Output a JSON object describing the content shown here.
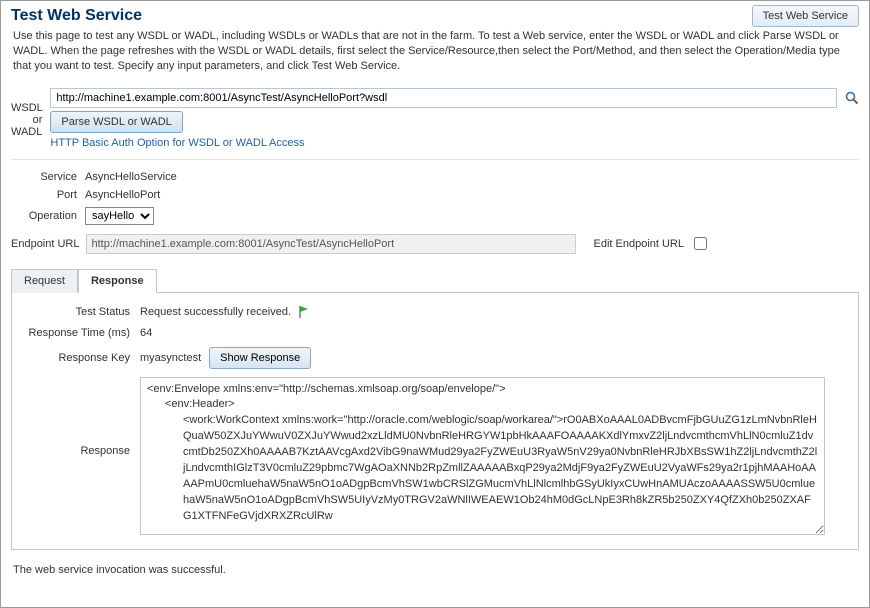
{
  "header": {
    "title": "Test Web Service",
    "button": "Test Web Service"
  },
  "intro": "Use this page to test any WSDL or WADL, including WSDLs or WADLs that are not in the farm. To test a Web service, enter the WSDL or WADL and click Parse WSDL or WADL. When the page refreshes with the WSDL or WADL details, first select the Service/Resource,then select the Port/Method, and then select the Operation/Media type that you want to test. Specify any input parameters, and click Test Web Service.",
  "wsdl": {
    "label": "WSDL or WADL",
    "url": "http://machine1.example.com:8001/AsyncTest/AsyncHelloPort?wsdl",
    "parse_btn": "Parse WSDL or WADL",
    "auth_link": "HTTP Basic Auth Option for WSDL or WADL Access"
  },
  "fields": {
    "service_label": "Service",
    "service_value": "AsyncHelloService",
    "port_label": "Port",
    "port_value": "AsyncHelloPort",
    "operation_label": "Operation",
    "operation_value": "sayHello",
    "endpoint_label": "Endpoint URL",
    "endpoint_value": "http://machine1.example.com:8001/AsyncTest/AsyncHelloPort",
    "edit_endpoint_label": "Edit Endpoint URL"
  },
  "tabs": {
    "request": "Request",
    "response": "Response"
  },
  "response": {
    "status_label": "Test Status",
    "status_value": "Request successfully received.",
    "time_label": "Response Time (ms)",
    "time_value": "64",
    "key_label": "Response Key",
    "key_value": "myasynctest",
    "show_btn": "Show Response",
    "body_label": "Response",
    "body_line1": "<env:Envelope xmlns:env=\"http://schemas.xmlsoap.org/soap/envelope/\">",
    "body_line2": "<env:Header>",
    "body_line3": "<work:WorkContext xmlns:work=\"http://oracle.com/weblogic/soap/workarea/\">rO0ABXoAAAL0ADBvcmFjbGUuZG1zLmNvbnRleHQuaW50ZXJuYWwuV0ZXJuYWwud2xzLldMU0NvbnRleHRGYW1pbHkAAAFOAAAAKXdlYmxvZ2ljLndvcmthcmVhLlN0cmluZ1dvcmtDb250ZXh0AAAAB7KztAAVcgAxd2VibG9naWMud29ya2FyZWEuU3RyaW5nV29ya0NvbnRleHRJbXBsSW1hZ2ljLndvcmthZ2ljLndvcmthIGlzT3V0cmluZ29pbmc7WgAOaXNNb2RpZmllZAAAAABxqP29ya2MdjF9ya2FyZWEuU2VyaWFs29ya2r1pjhMAAHoAAAAPmU0cmluehaW5naW5nO1oADgpBcmVhSW1wbCRSlZGMucmVhLlNlcmlhbGSyUkIyxCUwHnAMUAczoAAAASSW5U0cmluehaW5naW5nO1oADgpBcmVhSW5UIyVzMy0TRGV2aWNlIWEAEW1Ob24hM0dGcLNpE3Rh8kZR5b250ZXY4QfZXh0b250ZXAFG1XTFNFeGVjdXRXZRcUlRw"
  },
  "footer": "The web service invocation was successful."
}
